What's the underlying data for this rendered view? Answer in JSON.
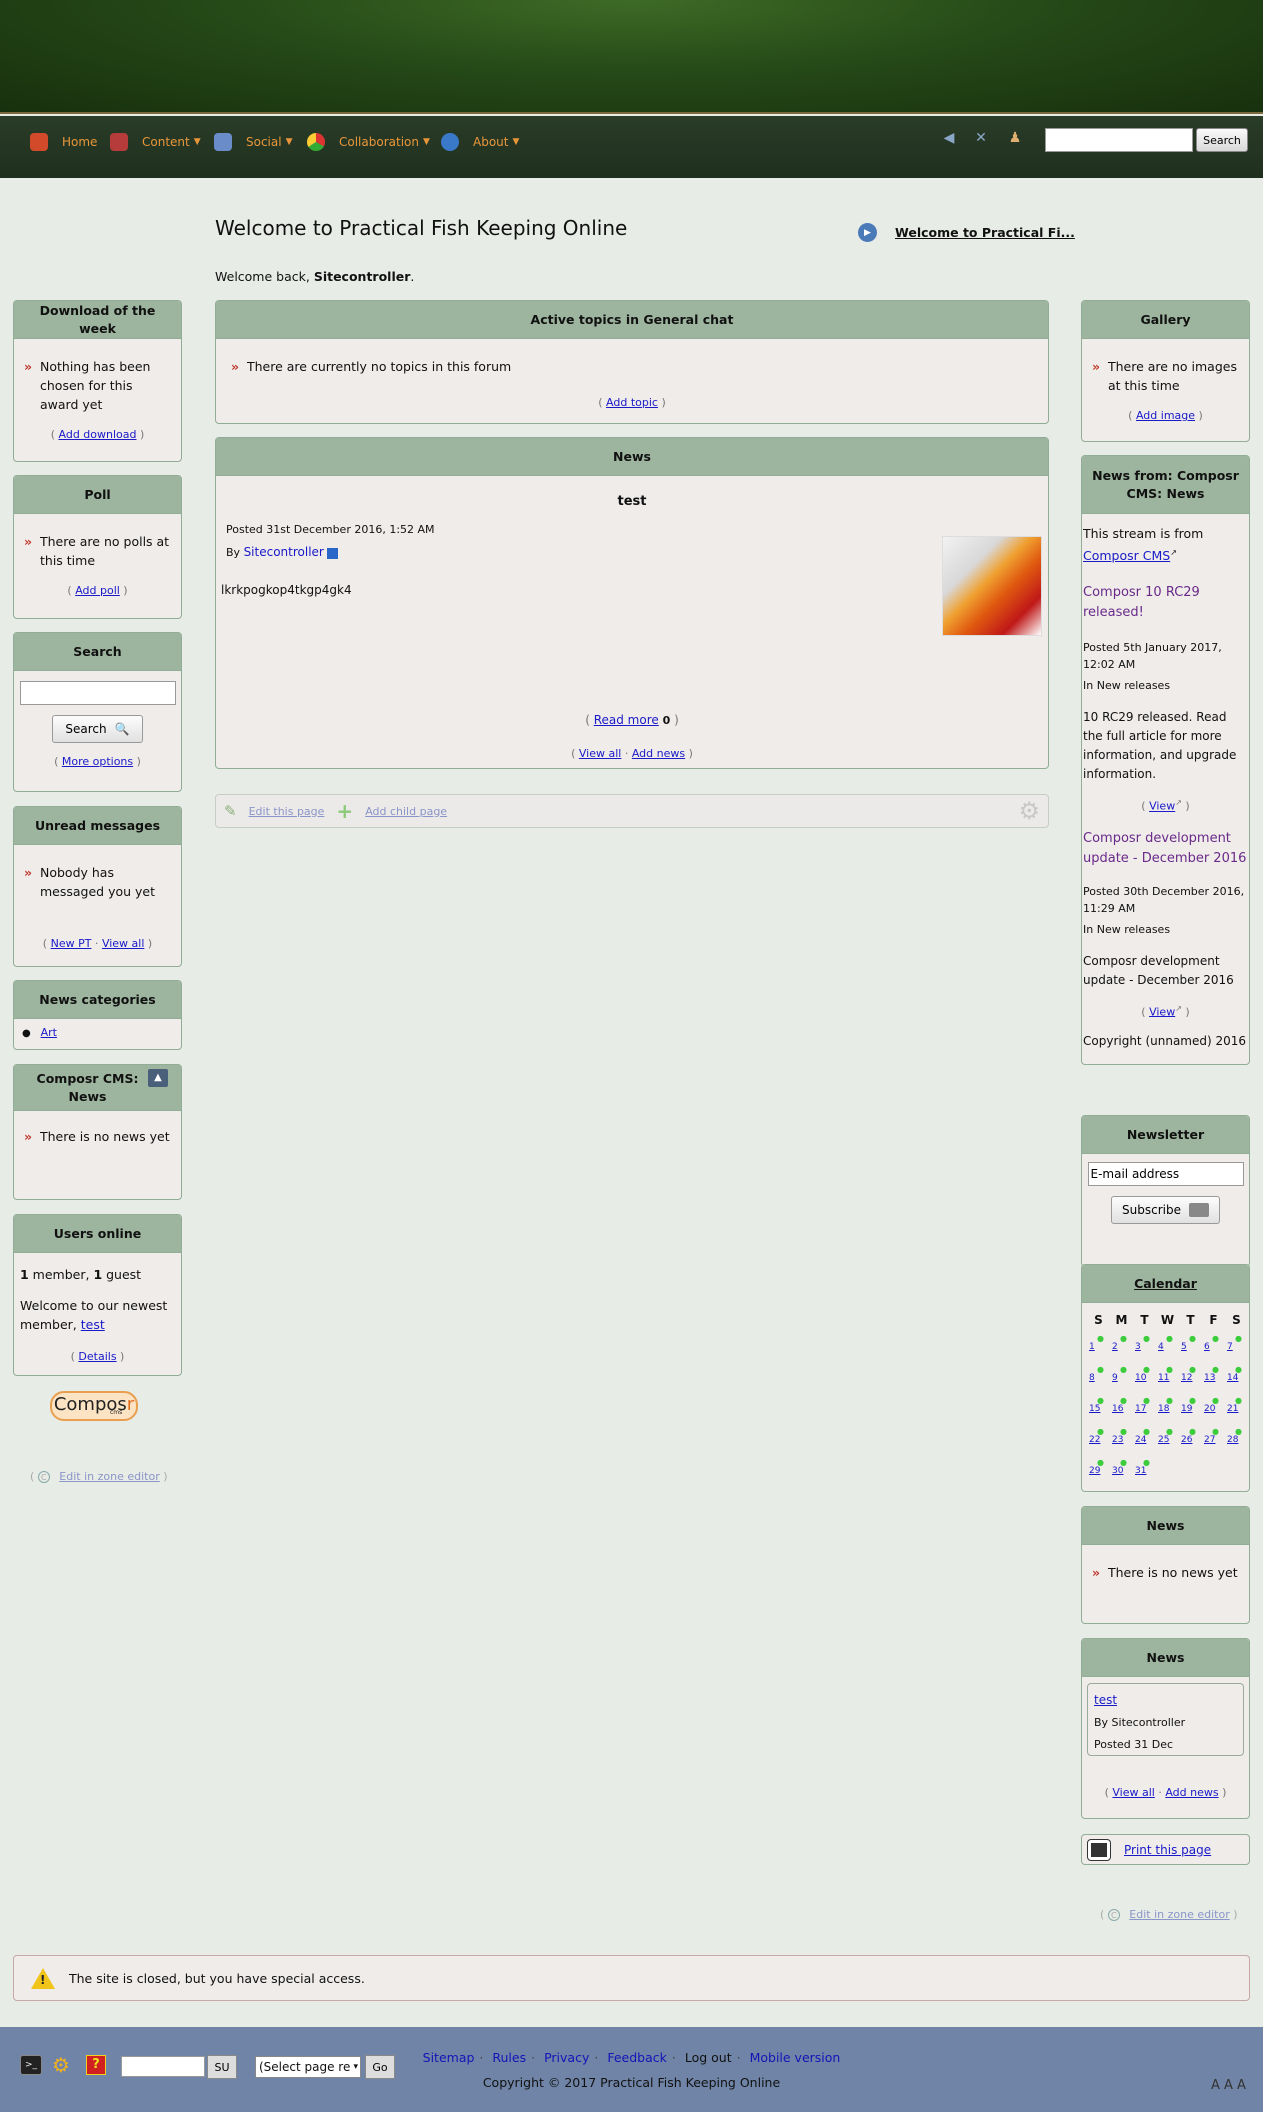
{
  "nav": {
    "items": [
      {
        "label": "Home",
        "color": "#d24a2a"
      },
      {
        "label": "Content",
        "color": "#c0392b"
      },
      {
        "label": "Social",
        "color": "#6a8cc9"
      },
      {
        "label": "Collaboration",
        "color": "#3aa53a"
      },
      {
        "label": "About",
        "color": "#3a78c9"
      }
    ],
    "search_button": "Search"
  },
  "main": {
    "title": "Welcome to Practical Fish Keeping Online",
    "welcome_prefix": "Welcome back, ",
    "welcome_user": "Sitecontroller",
    "welcome_suffix": ".",
    "feature_link": "Welcome to Practical Fi...",
    "topics": {
      "title": "Active topics in General chat",
      "empty": "There are currently no topics in this forum",
      "add": "Add topic"
    },
    "news": {
      "title": "News",
      "item_title": "test",
      "posted": "Posted 31st December 2016, 1:52 AM",
      "by": "By",
      "author": "Sitecontroller",
      "body": "lkrkpogkop4tkgp4gk4",
      "read_more": "Read more",
      "comments": "0",
      "view_all": "View all",
      "add_news": "Add news"
    },
    "edit_page": "Edit this page",
    "add_child": "Add child page"
  },
  "left": {
    "download": {
      "title": "Download of the week",
      "text": "Nothing has been chosen for this award yet",
      "link": "Add download"
    },
    "poll": {
      "title": "Poll",
      "text": "There are no polls at this time",
      "link": "Add poll"
    },
    "search": {
      "title": "Search",
      "button": "Search",
      "link": "More options"
    },
    "unread": {
      "title": "Unread messages",
      "text": "Nobody has messaged you yet",
      "link1": "New PT",
      "link2": "View all"
    },
    "categories": {
      "title": "News categories",
      "item": "Art"
    },
    "composr_news": {
      "title": "Composr CMS: News",
      "text": "There is no news yet"
    },
    "online": {
      "title": "Users online",
      "members_num": "1",
      "members_word": " member, ",
      "guests_num": "1",
      "guests_word": " guest",
      "newest_text": "Welcome to our newest member, ",
      "newest_user": "test",
      "link": "Details"
    },
    "logo": "Compos",
    "logo_r": "r",
    "logo_sub": "cms",
    "zone_editor": "Edit in zone editor"
  },
  "right": {
    "gallery": {
      "title": "Gallery",
      "text": "There are no images at this time",
      "link": "Add image"
    },
    "feed": {
      "title": "News from: Composr CMS: News",
      "intro": "This stream is from",
      "source": "Composr CMS",
      "items": [
        {
          "title": "Composr 10 RC29 released!",
          "posted": "Posted 5th January 2017, 12:02 AM",
          "category": "In New releases",
          "summary": "10 RC29 released. Read the full article for more information, and upgrade information.",
          "view": "View"
        },
        {
          "title": "Composr development update - December 2016",
          "posted": "Posted 30th December 2016, 11:29 AM",
          "category": "In New releases",
          "summary": "Composr development update - December 2016",
          "view": "View"
        }
      ],
      "copyright": "Copyright (unnamed) 2016"
    },
    "newsletter": {
      "title": "Newsletter",
      "placeholder": "E-mail address",
      "button": "Subscribe"
    },
    "calendar": {
      "title": "Calendar",
      "days": [
        "S",
        "M",
        "T",
        "W",
        "T",
        "F",
        "S"
      ],
      "dates": [
        "1",
        "2",
        "3",
        "4",
        "5",
        "6",
        "7",
        "8",
        "9",
        "10",
        "11",
        "12",
        "13",
        "14",
        "15",
        "16",
        "17",
        "18",
        "19",
        "20",
        "21",
        "22",
        "23",
        "24",
        "25",
        "26",
        "27",
        "28",
        "29",
        "30",
        "31"
      ]
    },
    "news_empty": {
      "title": "News",
      "text": "There is no news yet"
    },
    "news_list": {
      "title": "News",
      "item": "test",
      "by": "By Sitecontroller",
      "posted": "Posted 31 Dec",
      "view_all": "View all",
      "add_news": "Add news"
    },
    "print": "Print this page",
    "zone_editor": "Edit in zone editor"
  },
  "footer": {
    "notice": "The site is closed, but you have special access.",
    "su_button": "SU",
    "page_select": "(Select page re",
    "go_button": "Go",
    "links": [
      "Sitemap",
      "Rules",
      "Privacy",
      "Feedback",
      "Log out",
      "Mobile version"
    ],
    "copyright": "Copyright © 2017 Practical Fish Keeping Online",
    "font_sizer": "A A A"
  }
}
